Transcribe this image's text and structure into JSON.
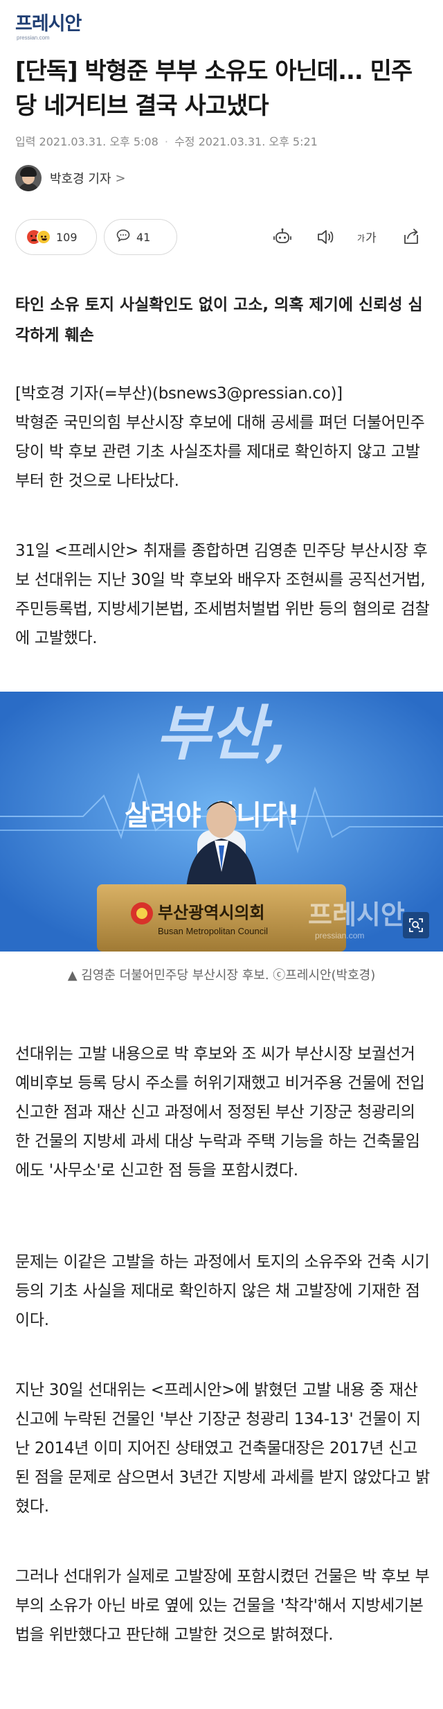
{
  "header": {
    "logo": "프레시안",
    "logo_sub": "pressian.com"
  },
  "article": {
    "title": "[단독] 박형준 부부 소유도 아닌데... 민주당 네거티브 결국 사고냈다",
    "input_label": "입력",
    "input_date": "2021.03.31. 오후 5:08",
    "modified_label": "수정",
    "modified_date": "2021.03.31. 오후 5:21",
    "reporter": "박호경 기자",
    "reporter_chevron": ">",
    "reactions_count": "109",
    "comments_count": "41",
    "lead": "타인 소유 토지 사실확인도 없이 고소, 의혹 제기에 신뢰성 심각하게 훼손",
    "paragraphs": [
      "[박호경 기자(=부산)(bsnews3@pressian.co)]\n박형준 국민의힘 부산시장 후보에 대해 공세를 펴던 더불어민주당이 박 후보 관련 기초 사실조차를 제대로 확인하지 않고 고발부터 한 것으로 나타났다.",
      "31일 <프레시안> 취재를 종합하면 김영춘 민주당 부산시장 후보 선대위는 지난 30일 박 후보와 배우자 조현씨를 공직선거법, 주민등록법, 지방세기본법, 조세범처벌법 위반 등의 혐의로 검찰에 고발했다.",
      "선대위는 고발 내용으로 박 후보와 조 씨가 부산시장 보궐선거 예비후보 등록 당시 주소를 허위기재했고 비거주용 건물에 전입 신고한 점과 재산 신고 과정에서 정정된 부산 기장군 청광리의 한 건물의 지방세 과세 대상 누락과 주택 기능을 하는 건축물임에도 '사무소'로 신고한 점 등을 포함시켰다.",
      "문제는 이같은 고발을 하는 과정에서 토지의 소유주와 건축 시기 등의 기초 사실을 제대로 확인하지 않은 채 고발장에 기재한 점이다.",
      "지난 30일 선대위는 <프레시안>에 밝혔던 고발 내용 중 재산 신고에 누락된 건물인 '부산 기장군 청광리 134-13' 건물이 지난 2014년 이미 지어진 상태였고 건축물대장은 2017년 신고된 점을 문제로 삼으면서 3년간 지방세 과세를 받지 않았다고 밝혔다.",
      "그러나 선대위가 실제로 고발장에 포함시켰던 건물은 박 후보 부부의 소유가 아닌 바로 옆에 있는 건물을 '착각'해서 지방세기본법을 위반했다고 판단해 고발한 것으로 밝혀졌다."
    ],
    "photo": {
      "banner_line1": "부산,",
      "banner_line2": "살려야 합니다!",
      "podium_text": "부산광역시의회",
      "podium_sub": "Busan Metropolitan Council",
      "watermark": "프레시안",
      "watermark_sub": "pressian.com",
      "caption": "▲ 김영춘 더불어민주당 부산시장 후보. ⓒ프레시안(박호경)"
    }
  },
  "colors": {
    "logo": "#1f3e73",
    "photo_bg": "#2d77d5",
    "podium": "#c79a47"
  },
  "icons": [
    "reaction-angry-icon",
    "reaction-laugh-icon",
    "comment-icon",
    "listen-bot-icon",
    "speaker-icon",
    "font-size-icon",
    "share-icon",
    "zoom-icon"
  ]
}
